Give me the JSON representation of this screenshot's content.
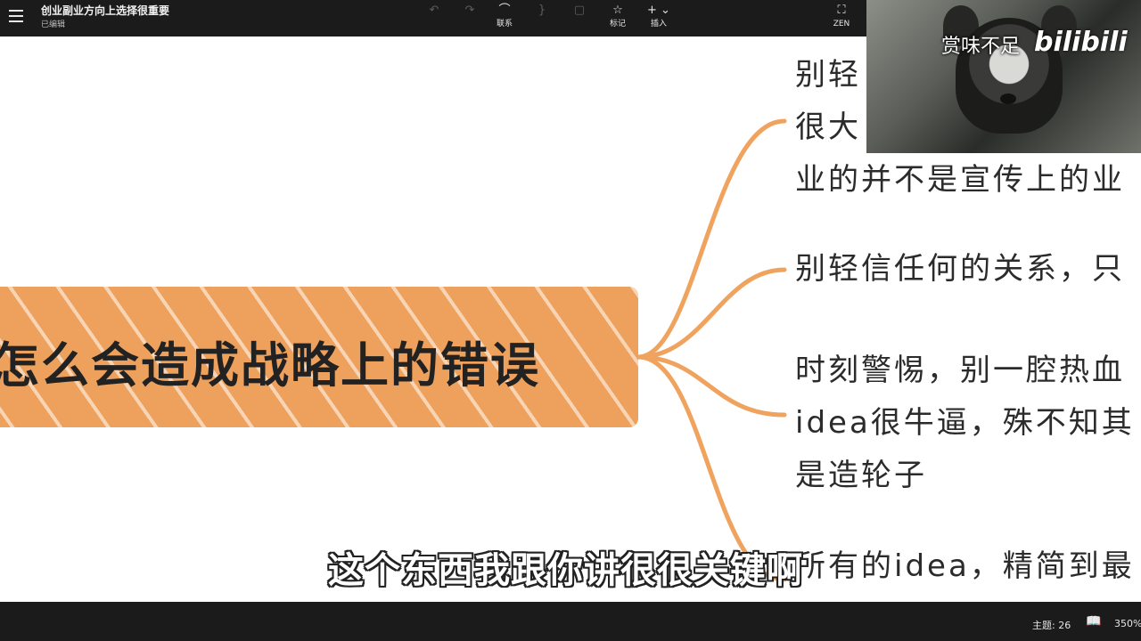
{
  "header": {
    "title": "创业副业方向上选择很重要",
    "status": "已编辑",
    "tools": [
      {
        "label": "",
        "icon": "undo-icon",
        "enabled": false
      },
      {
        "label": "",
        "icon": "redo-icon",
        "enabled": false
      },
      {
        "label": "联系",
        "icon": "relationship-icon",
        "enabled": true
      },
      {
        "label": "",
        "icon": "summary-icon",
        "enabled": false
      },
      {
        "label": "",
        "icon": "boundary-icon",
        "enabled": false
      },
      {
        "label": "标记",
        "icon": "marker-icon",
        "enabled": true
      },
      {
        "label": "插入",
        "icon": "insert-icon",
        "enabled": true
      }
    ],
    "zen_label": "ZEN"
  },
  "mindmap": {
    "root": "怎么会造成战略上的错误",
    "branches": [
      {
        "lines": [
          "别轻",
          "很大",
          "业的并不是宣传上的业"
        ]
      },
      {
        "lines": [
          "别轻信任何的关系，只"
        ]
      },
      {
        "lines": [
          "时刻警惕，别一腔热血",
          "idea很牛逼，殊不知其",
          "是造轮子"
        ]
      },
      {
        "lines": [
          "所有的idea，精简到最"
        ]
      }
    ],
    "colors": {
      "branch_line": "#f0a35e",
      "root_fill": "#eea15c"
    }
  },
  "video_overlay": {
    "caption": "赏味不足",
    "logo": "bilibili"
  },
  "subtitle": "这个东西我跟你讲很很关键啊",
  "statusbar": {
    "topics": "主题: 26",
    "zoom": "350%"
  }
}
